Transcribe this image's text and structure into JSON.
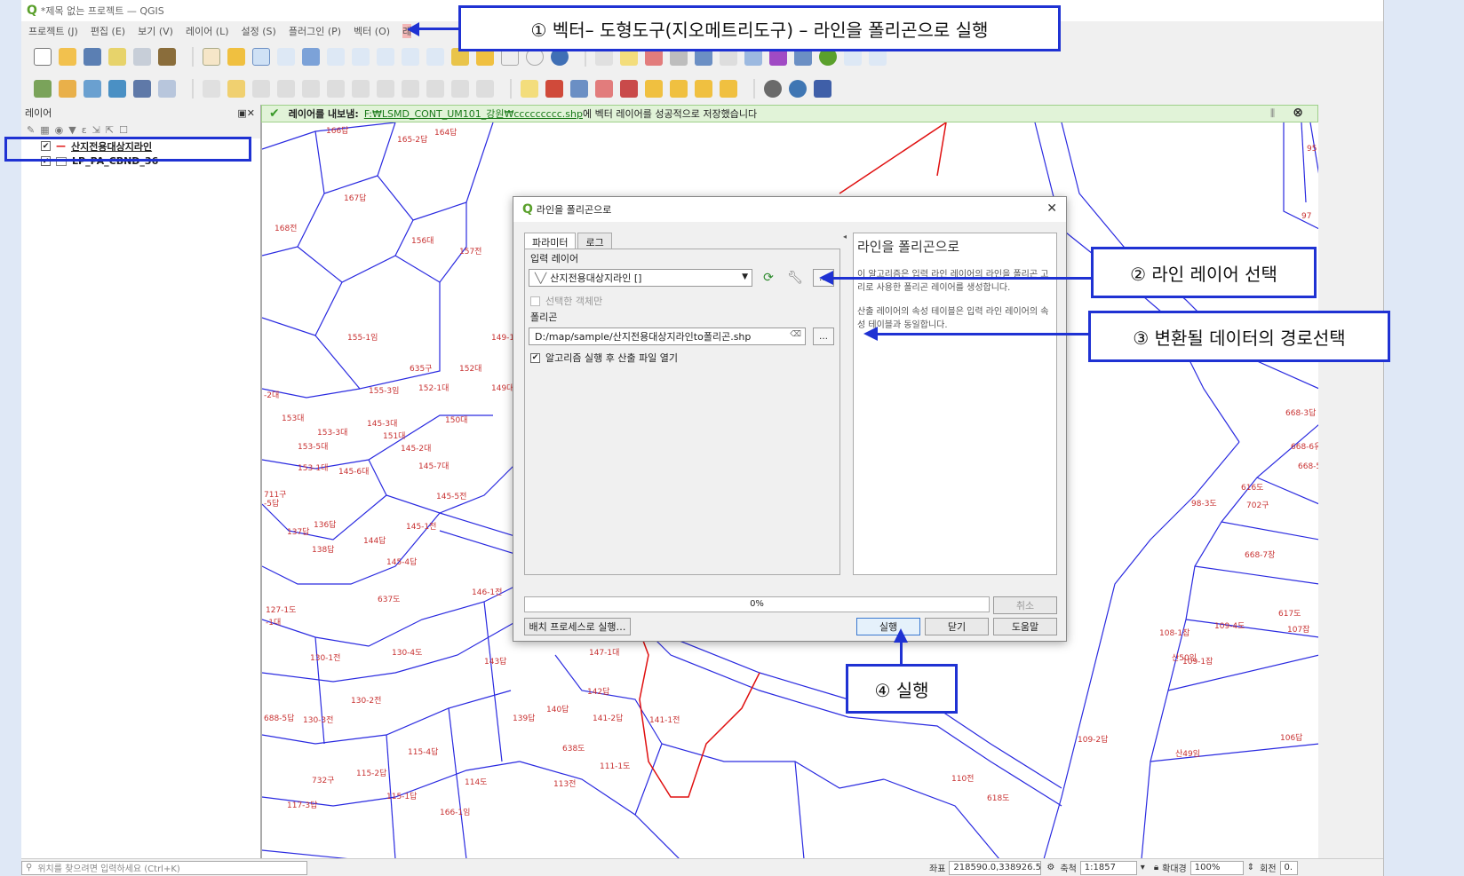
{
  "window": {
    "title": "*제목 없는 프로젝트 — QGIS"
  },
  "menu": [
    "프로젝트 (J)",
    "편집 (E)",
    "보기 (V)",
    "레이어 (L)",
    "설정 (S)",
    "플러그인 (P)",
    "벡터 (O)",
    "래"
  ],
  "layers_panel": {
    "title": "레이어",
    "layers": [
      {
        "name": "산지전용대상지라인",
        "checked": true,
        "symbol": "line"
      },
      {
        "name": "LP_PA_CBND_36",
        "checked": true,
        "symbol": "polygon"
      }
    ]
  },
  "message": {
    "title": "레이어를 내보냄:",
    "link": "F:₩LSMD_CONT_UM101_강원₩ccccccccc.shp",
    "text": "에 벡터 레이어를 성공적으로 저장했습니다"
  },
  "dialog": {
    "title": "라인을 폴리곤으로",
    "tabs": [
      "파라미터",
      "로그"
    ],
    "input_layer_label": "입력 레이어",
    "input_layer_value": "산지전용대상지라인 []",
    "selected_only_label": "선택한 객체만",
    "output_label": "폴리곤",
    "output_path": "D:/map/sample/산지전용대상지라인to폴리곤.shp",
    "open_output_label": "알고리즘 실행 후 산출 파일 열기",
    "help_title": "라인을 폴리곤으로",
    "help_p1": "이 알고리즘은 입력 라인 레이어의 라인을 폴리곤 고리로 사용한 폴리곤 레이어를 생성합니다.",
    "help_p2": "산출 레이어의 속성 테이블은 입력 라인 레이어의 속성 테이블과 동일합니다.",
    "progress": "0%",
    "cancel": "취소",
    "batch": "배치 프로세스로 실행…",
    "run": "실행",
    "close": "닫기",
    "help": "도움말"
  },
  "callouts": {
    "c1": "① 벡터– 도형도구(지오메트리도구) – 라인을 폴리곤으로 실행",
    "c2": "② 라인 레이어 선택",
    "c3": "③ 변환될 데이터의 경로선택",
    "c4": "④ 실행"
  },
  "statusbar": {
    "locator_placeholder": "위치를 찾으려면 입력하세요 (Ctrl+K)",
    "coord_label": "좌표",
    "coord_value": "218590.0,338926.5",
    "scale_label": "축척",
    "scale_value": "1:1857",
    "magnifier_label": "확대경",
    "magnifier_value": "100%",
    "rotation_label": "회전",
    "rotation_value": "0.",
    "render_label": "✓"
  },
  "map_labels": [
    "166답",
    "165-2답",
    "164답",
    "167답",
    "168전",
    "156대",
    "157전",
    "155-1임",
    "149-1",
    "635구",
    "152대",
    "155-3임",
    "152-1대",
    "149대",
    "-2대",
    "153대",
    "153-3대",
    "145-3대",
    "151대",
    "150대",
    "153-5대",
    "145-2대",
    "153-1대",
    "145-6대",
    "145-7대",
    "711구",
    "-5답",
    "145-5전",
    "136답",
    "137답",
    "145-1전",
    "144답",
    "138답",
    "145-4답",
    "146-1전",
    "637도",
    "127-1도",
    "-1대",
    "130-1전",
    "130-4도",
    "143답",
    "147-1대",
    "142답",
    "140답",
    "139답",
    "141-2답",
    "141-1전",
    "130-2전",
    "130-3전",
    "688-5답",
    "638도",
    "115-4답",
    "111-1도",
    "732구",
    "115-2답",
    "114도",
    "113전",
    "115-1답",
    "117-3답",
    "166-1임",
    "110전",
    "618도",
    "108-1잡",
    "109-4도",
    "109-1잡",
    "109-2답",
    "산49임",
    "산50임",
    "106답",
    "617도",
    "107잡",
    "616도",
    "98-3도",
    "702구",
    "668-7장",
    "668-3답",
    "668-6유",
    "668-5",
    "97",
    "95"
  ]
}
